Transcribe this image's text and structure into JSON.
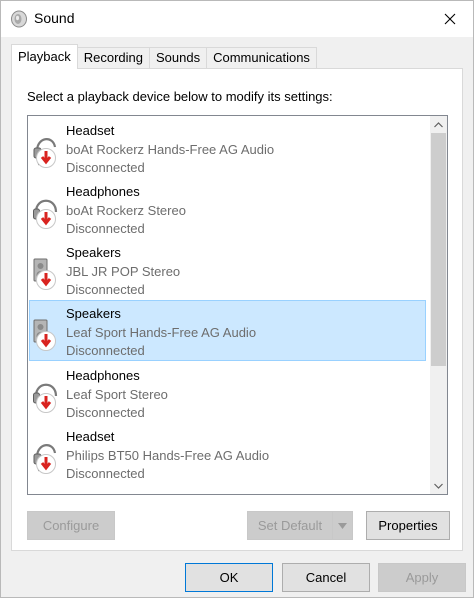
{
  "window": {
    "title": "Sound",
    "close_icon": "close-icon",
    "title_icon": "speaker-icon"
  },
  "tabs": [
    {
      "label": "Playback",
      "active": true
    },
    {
      "label": "Recording",
      "active": false
    },
    {
      "label": "Sounds",
      "active": false
    },
    {
      "label": "Communications",
      "active": false
    }
  ],
  "panel": {
    "instruction": "Select a playback device below to modify its settings:"
  },
  "devices": [
    {
      "name": "Headset",
      "description": "boAt Rockerz Hands-Free AG Audio",
      "status": "Disconnected",
      "icon": "headset-icon",
      "selected": false
    },
    {
      "name": "Headphones",
      "description": "boAt Rockerz Stereo",
      "status": "Disconnected",
      "icon": "headphones-icon",
      "selected": false
    },
    {
      "name": "Speakers",
      "description": "JBL JR POP Stereo",
      "status": "Disconnected",
      "icon": "speakers-icon",
      "selected": false
    },
    {
      "name": "Speakers",
      "description": "Leaf Sport Hands-Free AG Audio",
      "status": "Disconnected",
      "icon": "speakers-icon",
      "selected": true
    },
    {
      "name": "Headphones",
      "description": "Leaf Sport Stereo",
      "status": "Disconnected",
      "icon": "headphones-icon",
      "selected": false
    },
    {
      "name": "Headset",
      "description": "Philips BT50 Hands-Free AG Audio",
      "status": "Disconnected",
      "icon": "headset-icon",
      "selected": false
    }
  ],
  "buttons": {
    "configure": "Configure",
    "set_default": "Set Default",
    "properties": "Properties",
    "ok": "OK",
    "cancel": "Cancel",
    "apply": "Apply"
  },
  "colors": {
    "selection_bg": "#cce8ff",
    "selection_border": "#99d1ff",
    "disconnected_arrow": "#d9231f",
    "focus_border": "#0078d7"
  }
}
